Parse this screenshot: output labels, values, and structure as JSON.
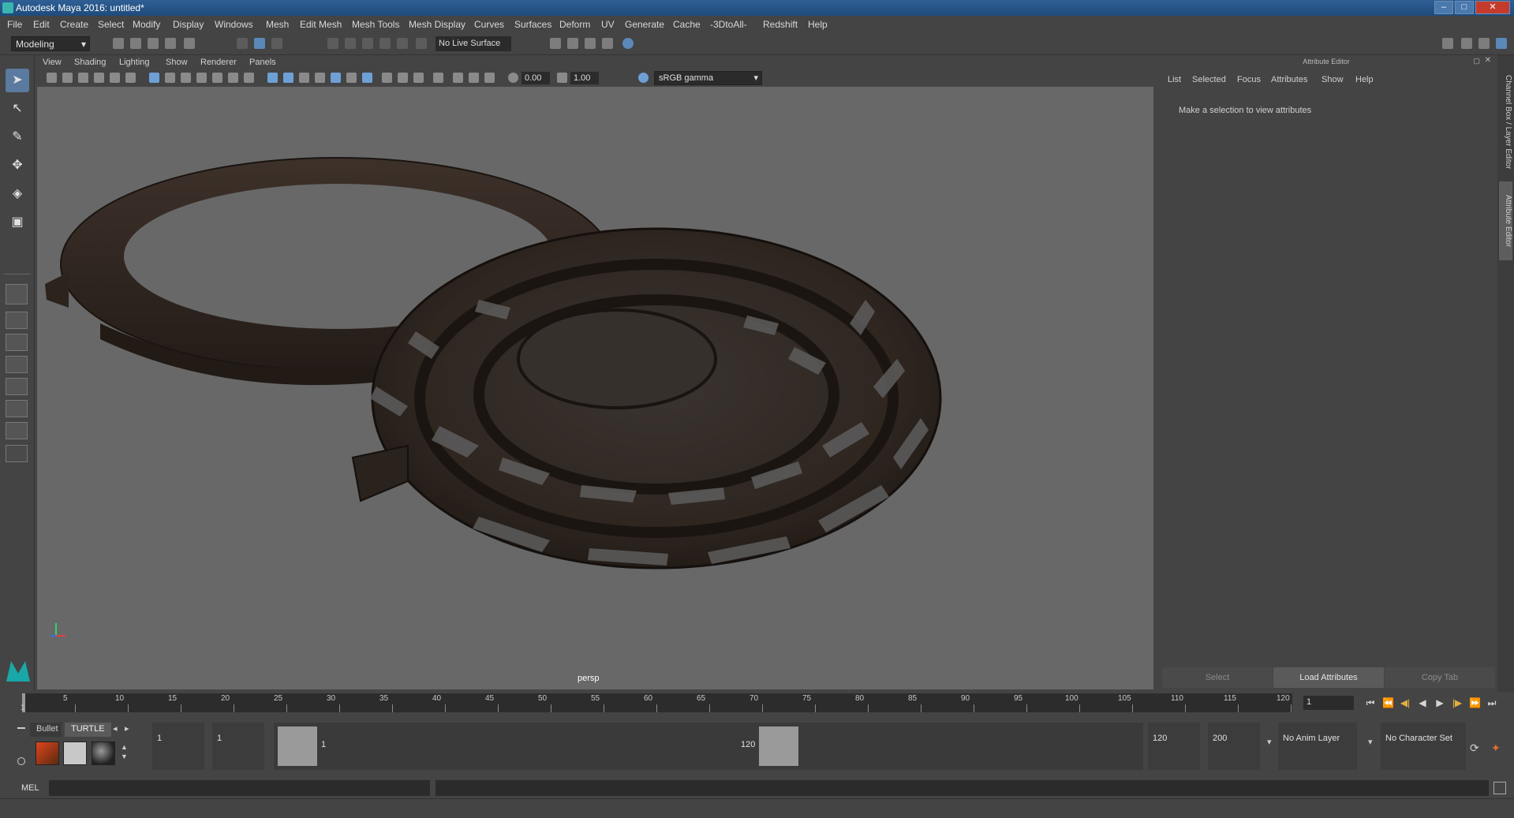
{
  "window": {
    "title": "Autodesk Maya 2016: untitled*",
    "minimize": "–",
    "maximize": "□",
    "close": "✕"
  },
  "menus": [
    "File",
    "Edit",
    "Create",
    "Select",
    "Modify",
    "Display",
    "Windows",
    "Mesh",
    "Edit Mesh",
    "Mesh Tools",
    "Mesh Display",
    "Curves",
    "Surfaces",
    "Deform",
    "UV",
    "Generate",
    "Cache",
    "-3DtoAll-",
    "Redshift",
    "Help"
  ],
  "shelf": {
    "mode": "Modeling",
    "live_surface": "No Live Surface"
  },
  "viewport": {
    "menus": [
      "View",
      "Shading",
      "Lighting",
      "Show",
      "Renderer",
      "Panels"
    ],
    "exposure": "0.00",
    "gamma_value": "1.00",
    "color_space": "sRGB gamma",
    "camera_label": "persp"
  },
  "attribute_editor": {
    "title": "Attribute Editor",
    "menus": [
      "List",
      "Selected",
      "Focus",
      "Attributes",
      "Show",
      "Help"
    ],
    "message": "Make a selection to view attributes",
    "buttons": {
      "select": "Select",
      "load": "Load Attributes",
      "copy": "Copy Tab"
    }
  },
  "side_tabs": {
    "channel_box": "Channel Box / Layer Editor",
    "attr_editor": "Attribute Editor"
  },
  "timeline": {
    "start_label": "1",
    "ticks": [
      "5",
      "10",
      "15",
      "20",
      "25",
      "30",
      "35",
      "40",
      "45",
      "50",
      "55",
      "60",
      "65",
      "70",
      "75",
      "80",
      "85",
      "90",
      "95",
      "100",
      "105",
      "110",
      "115",
      "120"
    ],
    "current_frame": "1"
  },
  "range": {
    "shelf_tabs": {
      "bullet": "Bullet",
      "turtle": "TURTLE"
    },
    "start": "1",
    "playback_start": "1",
    "handle_start": "1",
    "handle_end": "120",
    "playback_end": "120",
    "end": "200",
    "anim_layer": "No Anim Layer",
    "character_set": "No Character Set"
  },
  "mel": {
    "label": "MEL"
  }
}
